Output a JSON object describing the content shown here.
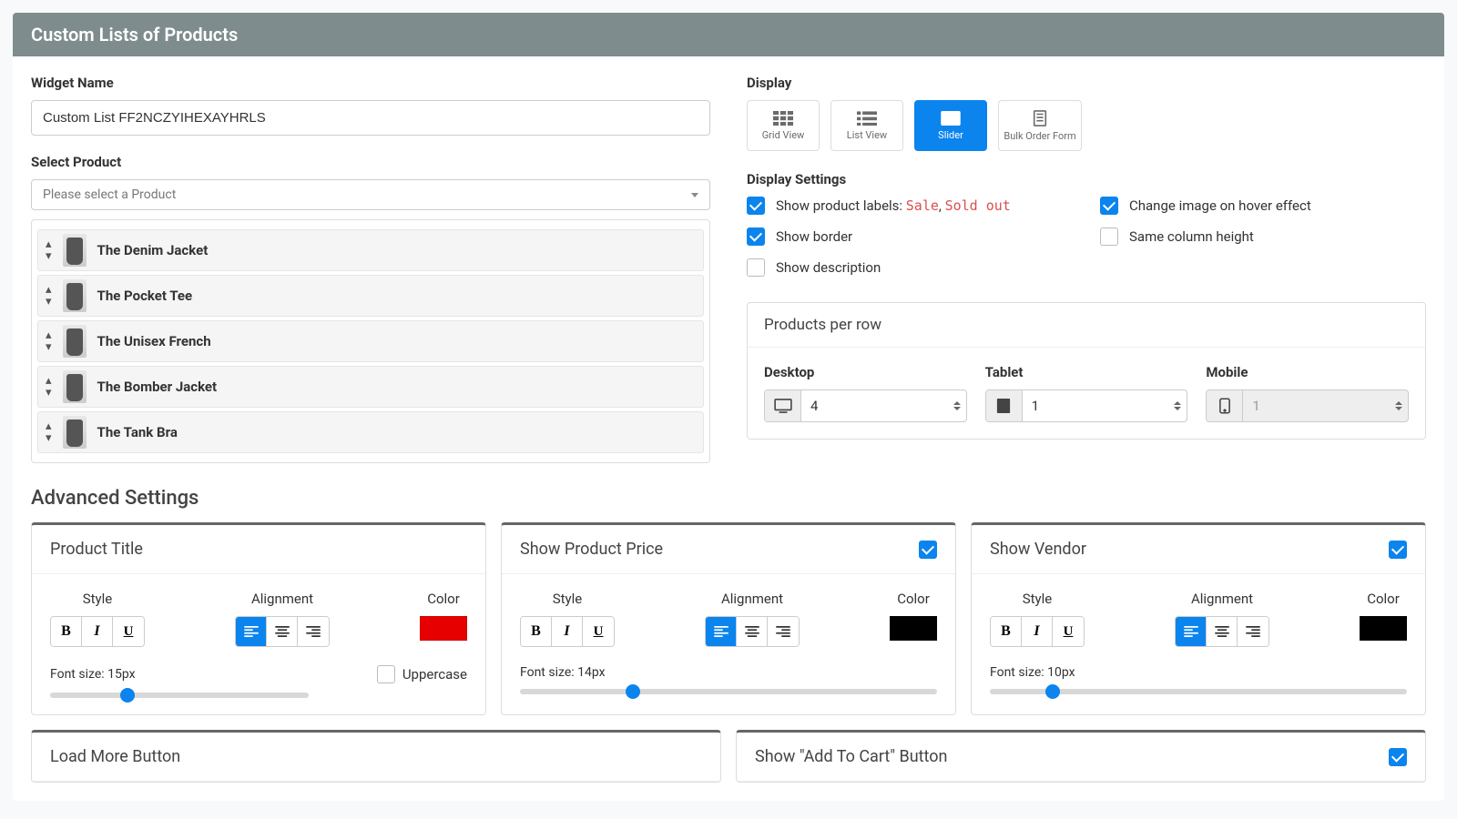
{
  "header": {
    "title": "Custom Lists of Products"
  },
  "widgetName": {
    "label": "Widget Name",
    "value": "Custom List FF2NCZYIHEXAYHRLS"
  },
  "selectProduct": {
    "label": "Select Product",
    "placeholder": "Please select a Product"
  },
  "products": [
    {
      "name": "The Denim Jacket"
    },
    {
      "name": "The Pocket Tee"
    },
    {
      "name": "The Unisex French"
    },
    {
      "name": "The Bomber Jacket"
    },
    {
      "name": "The Tank Bra"
    }
  ],
  "display": {
    "label": "Display",
    "options": {
      "grid": "Grid View",
      "list": "List View",
      "slider": "Slider",
      "bulk": "Bulk Order Form"
    }
  },
  "displaySettings": {
    "label": "Display Settings",
    "showLabelsPrefix": "Show product labels: ",
    "saleLabel": "Sale",
    "soldOutLabel": "Sold out",
    "showBorder": "Show border",
    "showDescription": "Show description",
    "changeHover": "Change image on hover effect",
    "sameHeight": "Same column height"
  },
  "productsPerRow": {
    "title": "Products per row",
    "desktop": {
      "label": "Desktop",
      "value": "4"
    },
    "tablet": {
      "label": "Tablet",
      "value": "1"
    },
    "mobile": {
      "label": "Mobile",
      "value": "1"
    }
  },
  "advanced": {
    "title": "Advanced Settings",
    "cards": {
      "productTitle": {
        "title": "Product Title",
        "styleLabel": "Style",
        "alignLabel": "Alignment",
        "colorLabel": "Color",
        "color": "#e60000",
        "fontSize": 15,
        "fontSizePrefix": "Font size: ",
        "fontSizeSuffix": "px",
        "uppercase": "Uppercase",
        "sliderPct": 30
      },
      "price": {
        "title": "Show Product Price",
        "styleLabel": "Style",
        "alignLabel": "Alignment",
        "colorLabel": "Color",
        "color": "#000000",
        "fontSize": 14,
        "fontSizePrefix": "Font size: ",
        "fontSizeSuffix": "px",
        "sliderPct": 27
      },
      "vendor": {
        "title": "Show Vendor",
        "styleLabel": "Style",
        "alignLabel": "Alignment",
        "colorLabel": "Color",
        "color": "#000000",
        "fontSize": 10,
        "fontSizePrefix": "Font size: ",
        "fontSizeSuffix": "px",
        "sliderPct": 15
      },
      "loadMore": {
        "title": "Load More Button"
      },
      "addToCart": {
        "title": "Show \"Add To Cart\" Button"
      }
    }
  }
}
